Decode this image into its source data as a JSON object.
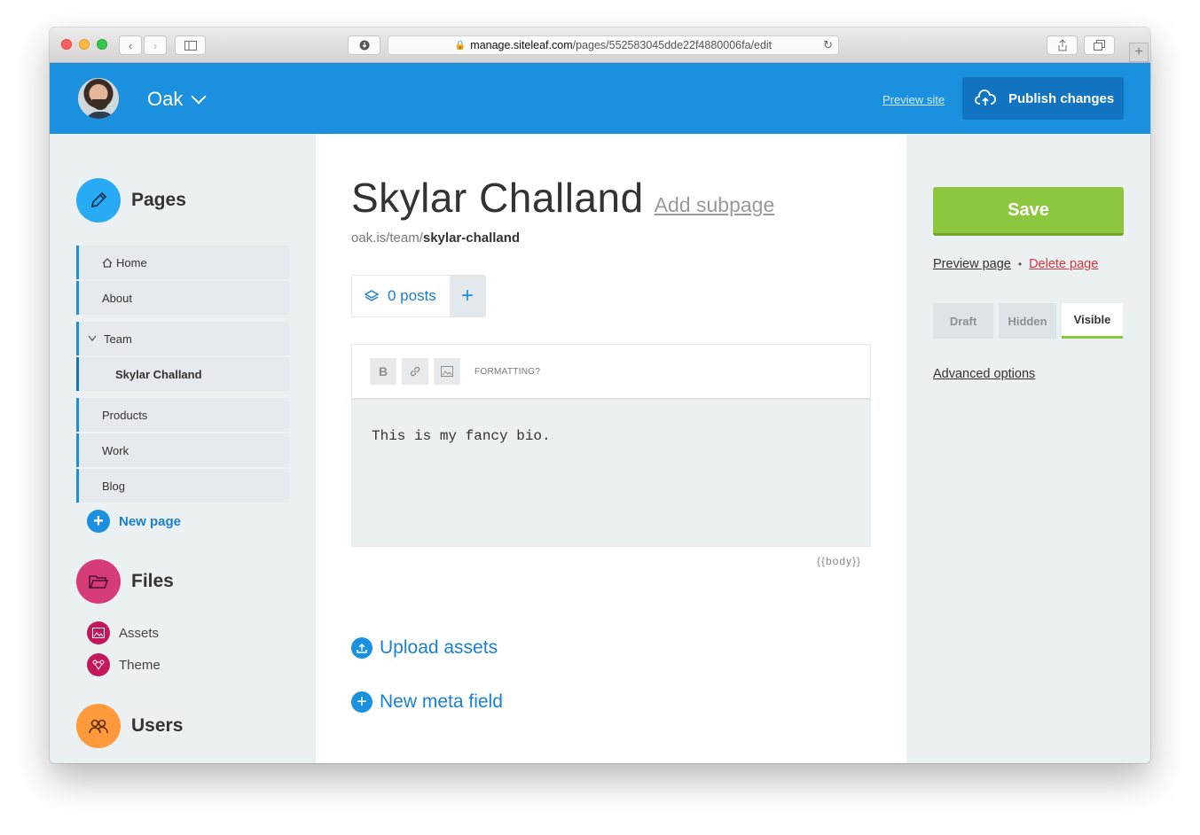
{
  "browser": {
    "url_host": "manage.siteleaf.com",
    "url_path": "/pages/552583045dde22f4880006fa/edit"
  },
  "header": {
    "site_name": "Oak",
    "preview_site": "Preview site",
    "publish": "Publish changes"
  },
  "sidebar": {
    "pages_title": "Pages",
    "pages": [
      {
        "label": "Home"
      },
      {
        "label": "About"
      },
      {
        "label": "Team"
      },
      {
        "label": "Skylar Challand"
      },
      {
        "label": "Products"
      },
      {
        "label": "Work"
      },
      {
        "label": "Blog"
      }
    ],
    "new_page": "New page",
    "files_title": "Files",
    "files": [
      {
        "label": "Assets"
      },
      {
        "label": "Theme"
      }
    ],
    "users_title": "Users"
  },
  "main": {
    "title": "Skylar Challand",
    "add_subpage": "Add subpage",
    "slug_prefix": "oak.is/team/",
    "slug": "skylar-challand",
    "posts": "0 posts",
    "toolbar": {
      "bold": "B",
      "formatting": "FORMATTING?"
    },
    "body_text": "This is my fancy bio.",
    "body_tag": "{{body}}",
    "upload_assets": "Upload assets",
    "new_meta": "New meta field"
  },
  "right": {
    "save": "Save",
    "preview_page": "Preview page",
    "delete_page": "Delete page",
    "visibility": [
      "Draft",
      "Hidden",
      "Visible"
    ],
    "visibility_selected": "Visible",
    "advanced": "Advanced options"
  },
  "colors": {
    "brand_blue": "#1a90df",
    "save_green": "#8dc63f",
    "delete_red": "#d9363e",
    "files_pink": "#c2185b",
    "users_orange": "#ff9a3c"
  },
  "icons": [
    "pencil-icon",
    "home-icon",
    "chevron-down-icon",
    "folder-icon",
    "image-icon",
    "theme-icon",
    "users-icon",
    "layers-icon",
    "cloud-upload-icon",
    "link-icon",
    "upload-icon",
    "plus-icon"
  ]
}
